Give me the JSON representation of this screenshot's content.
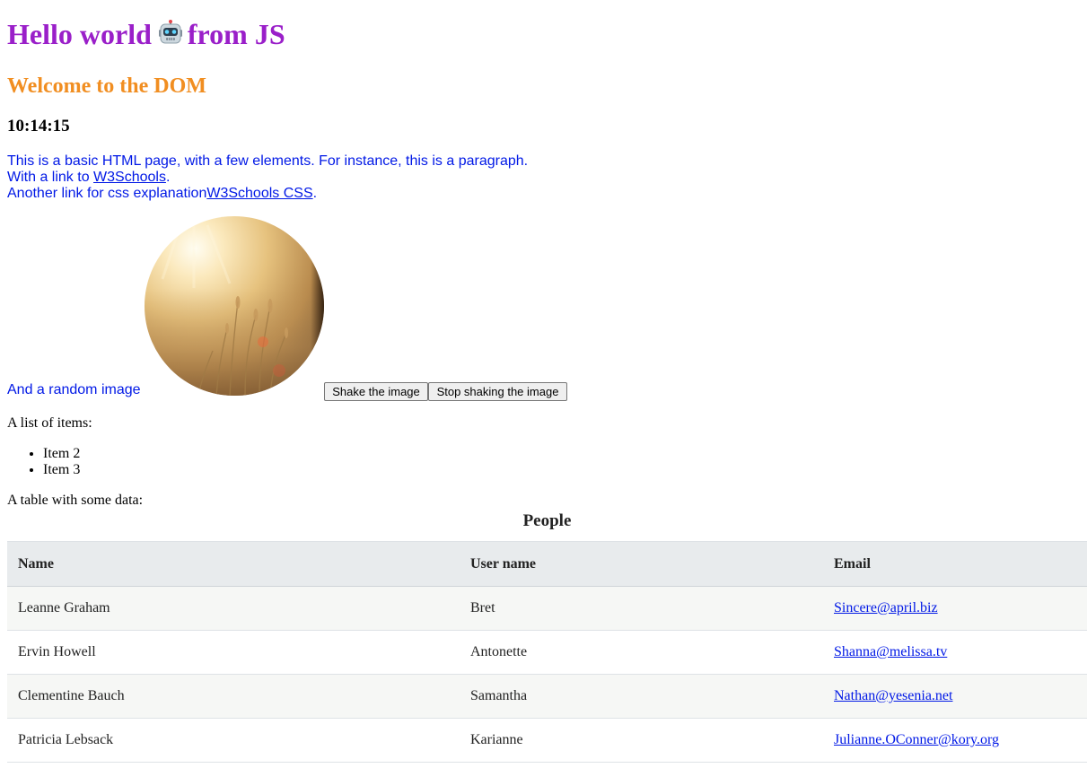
{
  "header": {
    "title_prefix": "Hello world",
    "title_suffix": "from JS",
    "subtitle": "Welcome to the DOM",
    "clock": "10:14:15"
  },
  "intro": {
    "line1": "This is a basic HTML page, with a few elements. For instance, this is a paragraph.",
    "line2_prefix": "With a link to ",
    "link1_text": "W3Schools",
    "line2_suffix": ".",
    "line3_prefix": "Another link for css explanation",
    "link2_text": "W3Schools CSS",
    "line3_suffix": "."
  },
  "image_section": {
    "caption": "And a random image",
    "shake_button": "Shake the image",
    "stop_button": "Stop shaking the image"
  },
  "list_section": {
    "label": "A list of items:",
    "items": [
      "Item 2",
      "Item 3"
    ]
  },
  "table_section": {
    "label": "A table with some data:",
    "caption": "People",
    "headers": [
      "Name",
      "User name",
      "Email"
    ],
    "rows": [
      {
        "name": "Leanne Graham",
        "username": "Bret",
        "email": "Sincere@april.biz"
      },
      {
        "name": "Ervin Howell",
        "username": "Antonette",
        "email": "Shanna@melissa.tv"
      },
      {
        "name": "Clementine Bauch",
        "username": "Samantha",
        "email": "Nathan@yesenia.net"
      },
      {
        "name": "Patricia Lebsack",
        "username": "Karianne",
        "email": "Julianne.OConner@kory.org"
      }
    ]
  },
  "colors": {
    "title": "#9a1fc9",
    "subtitle": "#f18e21",
    "intro_text": "#0018e6",
    "table_header_bg": "#e8ebed",
    "table_odd_row_bg": "#f6f7f5"
  }
}
